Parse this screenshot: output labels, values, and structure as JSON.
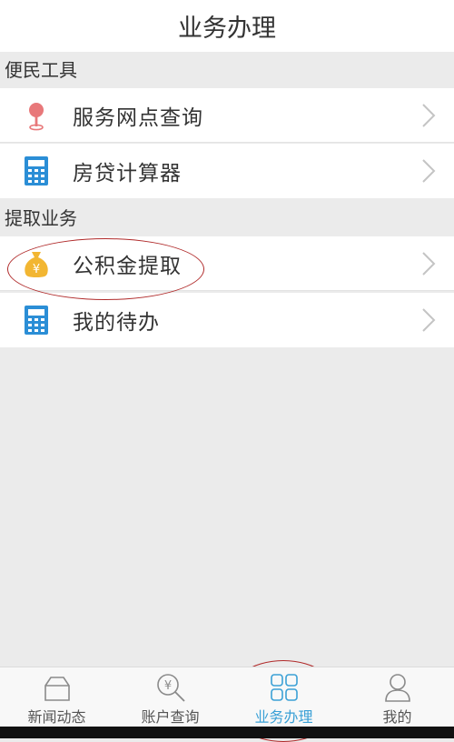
{
  "header": {
    "title": "业务办理"
  },
  "sections": [
    {
      "title": "便民工具",
      "items": [
        {
          "label": "服务网点查询",
          "icon": "map-pin-icon"
        },
        {
          "label": "房贷计算器",
          "icon": "calculator-icon"
        }
      ]
    },
    {
      "title": "提取业务",
      "items": [
        {
          "label": "公积金提取",
          "icon": "money-bag-icon"
        },
        {
          "label": "我的待办",
          "icon": "calculator-icon"
        }
      ]
    }
  ],
  "tabbar": {
    "tabs": [
      {
        "label": "新闻动态",
        "icon": "house-icon",
        "active": false
      },
      {
        "label": "账户查询",
        "icon": "yen-search-icon",
        "active": false
      },
      {
        "label": "业务办理",
        "icon": "grid-icon",
        "active": true
      },
      {
        "label": "我的",
        "icon": "user-icon",
        "active": false
      }
    ]
  },
  "colors": {
    "accent": "#3aa0d6",
    "annotation": "#b02a2a",
    "background": "#ebebeb"
  }
}
